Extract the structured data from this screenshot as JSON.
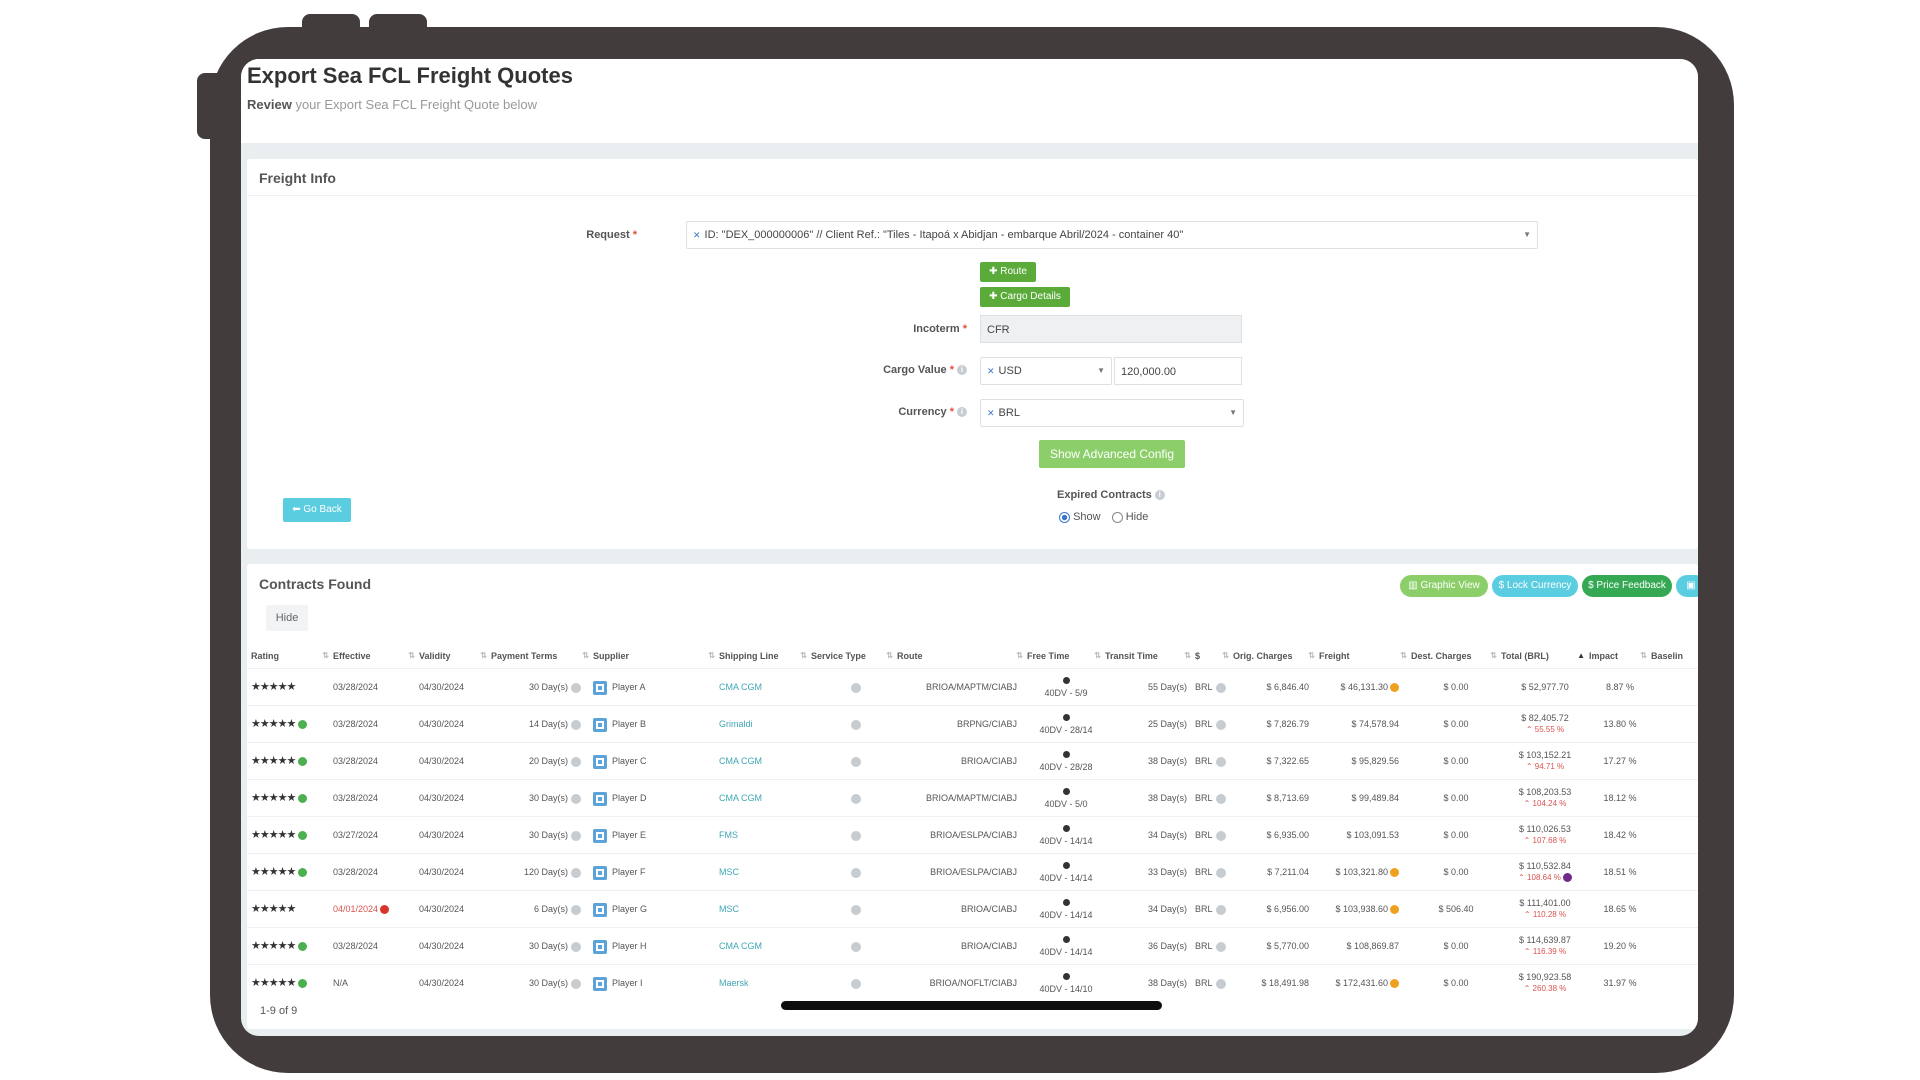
{
  "page": {
    "title": "Export Sea FCL Freight Quotes",
    "subtitle_bold": "Review",
    "subtitle_rest": "your Export Sea FCL Freight Quote below"
  },
  "freight_info": {
    "title": "Freight Info",
    "request_label": "Request",
    "request_value": "ID: \"DEX_000000006\" // Client Ref.: \"Tiles - Itapoá x Abidjan - embarque Abril/2024 - container 40\"",
    "route_button": "Route",
    "cargo_button": "Cargo Details",
    "incoterm_label": "Incoterm",
    "incoterm_value": "CFR",
    "cargo_value_label": "Cargo Value",
    "cargo_currency": "USD",
    "cargo_amount": "120,000.00",
    "currency_label": "Currency",
    "currency_value": "BRL",
    "advanced_button": "Show Advanced Config",
    "go_back_button": "Go Back",
    "expired_label": "Expired Contracts",
    "show_label": "Show",
    "hide_label": "Hide"
  },
  "contracts": {
    "title": "Contracts Found",
    "hide_button": "Hide",
    "graphic_view": "Graphic View",
    "lock_currency": "$ Lock Currency",
    "price_feedback": "$ Price Feedback",
    "pagination": "1-9 of 9",
    "columns": [
      "Rating",
      "Effective",
      "Validity",
      "Payment Terms",
      "Supplier",
      "Shipping Line",
      "Service Type",
      "Route",
      "Free Time",
      "Transit Time",
      "$",
      "Orig. Charges",
      "Freight",
      "Dest. Charges",
      "Total (BRL)",
      "Impact",
      "Baselin"
    ],
    "rows": [
      {
        "effective": "03/28/2024",
        "validity": "04/30/2024",
        "payment": "30 Day(s)",
        "supplier": "Player A",
        "line": "CMA CGM",
        "route": "BRIOA/MAPTM/CIABJ",
        "free": "40DV - 5/9",
        "transit": "55 Day(s)",
        "cur": "BRL",
        "orig": "$ 6,846.40",
        "freight": "$ 46,131.30",
        "dest": "$ 0.00",
        "total": "$ 52,977.70",
        "total_sub": "",
        "impact": "8.87 %"
      },
      {
        "effective": "03/28/2024",
        "validity": "04/30/2024",
        "payment": "14 Day(s)",
        "supplier": "Player B",
        "line": "Grimaldi",
        "route": "BRPNG/CIABJ",
        "free": "40DV - 28/14",
        "transit": "25 Day(s)",
        "cur": "BRL",
        "orig": "$ 7,826.79",
        "freight": "$ 74,578.94",
        "dest": "$ 0.00",
        "total": "$ 82,405.72",
        "total_sub": "55.55 %",
        "impact": "13.80 %"
      },
      {
        "effective": "03/28/2024",
        "validity": "04/30/2024",
        "payment": "20 Day(s)",
        "supplier": "Player C",
        "line": "CMA CGM",
        "route": "BRIOA/CIABJ",
        "free": "40DV - 28/28",
        "transit": "38 Day(s)",
        "cur": "BRL",
        "orig": "$ 7,322.65",
        "freight": "$ 95,829.56",
        "dest": "$ 0.00",
        "total": "$ 103,152.21",
        "total_sub": "94.71 %",
        "impact": "17.27 %"
      },
      {
        "effective": "03/28/2024",
        "validity": "04/30/2024",
        "payment": "30 Day(s)",
        "supplier": "Player D",
        "line": "CMA CGM",
        "route": "BRIOA/MAPTM/CIABJ",
        "free": "40DV - 5/0",
        "transit": "38 Day(s)",
        "cur": "BRL",
        "orig": "$ 8,713.69",
        "freight": "$ 99,489.84",
        "dest": "$ 0.00",
        "total": "$ 108,203.53",
        "total_sub": "104.24 %",
        "impact": "18.12 %"
      },
      {
        "effective": "03/27/2024",
        "validity": "04/30/2024",
        "payment": "30 Day(s)",
        "supplier": "Player E",
        "line": "FMS",
        "route": "BRIOA/ESLPA/CIABJ",
        "free": "40DV - 14/14",
        "transit": "34 Day(s)",
        "cur": "BRL",
        "orig": "$ 6,935.00",
        "freight": "$ 103,091.53",
        "dest": "$ 0.00",
        "total": "$ 110,026.53",
        "total_sub": "107.68 %",
        "impact": "18.42 %"
      },
      {
        "effective": "03/28/2024",
        "validity": "04/30/2024",
        "payment": "120 Day(s)",
        "supplier": "Player F",
        "line": "MSC",
        "route": "BRIOA/ESLPA/CIABJ",
        "free": "40DV - 14/14",
        "transit": "33 Day(s)",
        "cur": "BRL",
        "orig": "$ 7,211.04",
        "freight": "$ 103,321.80",
        "dest": "$ 0.00",
        "total": "$ 110,532.84",
        "total_sub": "108.64 %",
        "impact": "18.51 %"
      },
      {
        "effective": "04/01/2024",
        "validity": "04/30/2024",
        "payment": "6 Day(s)",
        "supplier": "Player G",
        "line": "MSC",
        "route": "BRIOA/CIABJ",
        "free": "40DV - 14/14",
        "transit": "34 Day(s)",
        "cur": "BRL",
        "orig": "$ 6,956.00",
        "freight": "$ 103,938.60",
        "dest": "$ 506.40",
        "total": "$ 111,401.00",
        "total_sub": "110.28 %",
        "impact": "18.65 %"
      },
      {
        "effective": "03/28/2024",
        "validity": "04/30/2024",
        "payment": "30 Day(s)",
        "supplier": "Player H",
        "line": "CMA CGM",
        "route": "BRIOA/CIABJ",
        "free": "40DV - 14/14",
        "transit": "36 Day(s)",
        "cur": "BRL",
        "orig": "$ 5,770.00",
        "freight": "$ 108,869.87",
        "dest": "$ 0.00",
        "total": "$ 114,639.87",
        "total_sub": "116.39 %",
        "impact": "19.20 %"
      },
      {
        "effective": "N/A",
        "validity": "04/30/2024",
        "payment": "30 Day(s)",
        "supplier": "Player I",
        "line": "Maersk",
        "route": "BRIOA/NOFLT/CIABJ",
        "free": "40DV - 14/10",
        "transit": "38 Day(s)",
        "cur": "BRL",
        "orig": "$ 18,491.98",
        "freight": "$ 172,431.60",
        "dest": "$ 0.00",
        "total": "$ 190,923.58",
        "total_sub": "260.38 %",
        "impact": "31.97 %"
      }
    ]
  }
}
